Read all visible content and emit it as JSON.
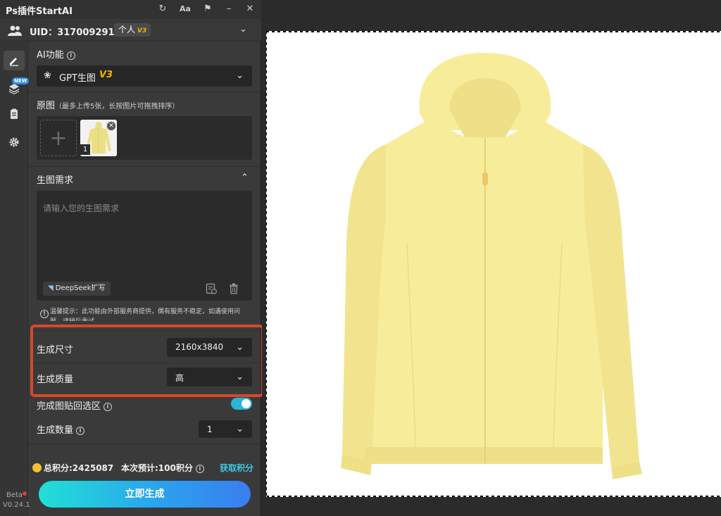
{
  "app": {
    "title": "Ps插件StartAI",
    "titlebar_icons": [
      "refresh-icon",
      "font-size-icon",
      "pin-icon",
      "minimize-icon",
      "close-icon"
    ],
    "font_label": "Aa"
  },
  "user": {
    "uid_text": "UID：317009291",
    "plan": "个人",
    "plan_tier": "V3"
  },
  "sidebar": {
    "new_badge": "NEW",
    "beta_label": "Beta",
    "version": "V0.24.1"
  },
  "ai_function": {
    "label": "AI功能",
    "selected_model": "GPT生图",
    "model_tier": "V3"
  },
  "original_image": {
    "label": "原图",
    "hint": "（最多上传5张，长按图片可拖拽排序）",
    "thumbnail_index": "1"
  },
  "prompt": {
    "section_label": "生图需求",
    "placeholder": "请输入您的生图需求",
    "deepseek_label": "DeepSeek扩写",
    "tip": "温馨提示：此功能由外部服务商提供，偶有服务不稳定，如遇使用问题，请稍后重试"
  },
  "settings": {
    "size_label": "生成尺寸",
    "size_value": "2160x3840",
    "quality_label": "生成质量",
    "quality_value": "高",
    "paste_back_label": "完成图贴回选区",
    "paste_back_enabled": true,
    "count_label": "生成数量",
    "count_value": "1"
  },
  "footer": {
    "total_points": "总积分:2425087",
    "estimate": "本次预计:100积分",
    "get_points": "获取积分",
    "generate_button": "立即生成"
  },
  "colors": {
    "panel_bg": "#3a3a3a",
    "accent_cyan": "#29b6d6",
    "highlight_red": "#d9472b",
    "v3_gold": "#f5b400",
    "jacket_yellow": "#f7ec9a"
  }
}
